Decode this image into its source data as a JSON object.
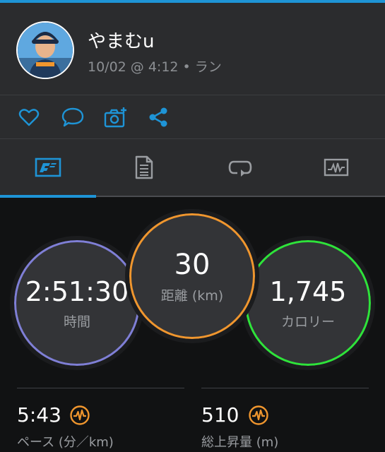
{
  "colors": {
    "accent": "#1e94d6",
    "time_ring": "#7f7fd6",
    "distance_ring": "#f0962e",
    "calories_ring": "#2ee33a",
    "performance_icon": "#f0962e"
  },
  "header": {
    "username": "やまむu",
    "meta": "10/02 @ 4:12 • ラン"
  },
  "actions": [
    {
      "icon": "heart-icon"
    },
    {
      "icon": "comment-icon"
    },
    {
      "icon": "add-photo-icon"
    },
    {
      "icon": "share-icon"
    }
  ],
  "tabs": [
    {
      "icon": "summary-flag-icon",
      "active": true
    },
    {
      "icon": "details-document-icon",
      "active": false
    },
    {
      "icon": "laps-icon",
      "active": false
    },
    {
      "icon": "chart-icon",
      "active": false
    }
  ],
  "circles": {
    "time": {
      "value": "2:51:30",
      "label": "時間"
    },
    "distance": {
      "value": "30",
      "label": "距離 (km)"
    },
    "calories": {
      "value": "1,745",
      "label": "カロリー"
    }
  },
  "stats": {
    "pace": {
      "value": "5:43",
      "label": "ペース (分／km)"
    },
    "ascent": {
      "value": "510",
      "label": "総上昇量 (m)"
    }
  }
}
